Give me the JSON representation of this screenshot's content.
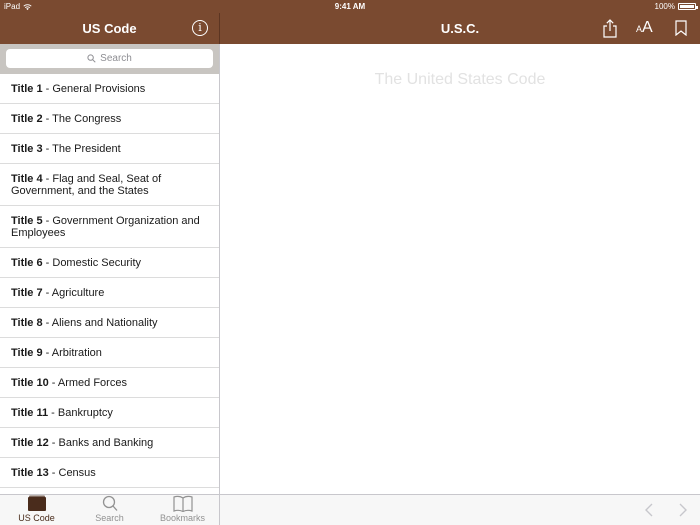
{
  "status": {
    "device": "iPad",
    "time": "9:41 AM",
    "battery": "100%"
  },
  "left_nav": {
    "title": "US Code",
    "info_glyph": "i"
  },
  "right_nav": {
    "title": "U.S.C.",
    "font_small": "A",
    "font_large": "A"
  },
  "search": {
    "placeholder": "Search"
  },
  "titles": [
    {
      "num": "Title 1",
      "name": " - General Provisions"
    },
    {
      "num": "Title 2",
      "name": " - The Congress"
    },
    {
      "num": "Title 3",
      "name": " - The President"
    },
    {
      "num": "Title 4",
      "name": " - Flag and Seal, Seat of Government, and the States"
    },
    {
      "num": "Title 5",
      "name": " - Government Organization and Employees"
    },
    {
      "num": "Title 6",
      "name": " - Domestic Security"
    },
    {
      "num": "Title 7",
      "name": " - Agriculture"
    },
    {
      "num": "Title 8",
      "name": " - Aliens and Nationality"
    },
    {
      "num": "Title 9",
      "name": " - Arbitration"
    },
    {
      "num": "Title 10",
      "name": " - Armed Forces"
    },
    {
      "num": "Title 11",
      "name": " - Bankruptcy"
    },
    {
      "num": "Title 12",
      "name": " - Banks and Banking"
    },
    {
      "num": "Title 13",
      "name": " - Census"
    }
  ],
  "content": {
    "title": "The United States Code"
  },
  "tabs": [
    {
      "label": "US Code",
      "icon": "us-code-icon"
    },
    {
      "label": "Search",
      "icon": "search-icon"
    },
    {
      "label": "Bookmarks",
      "icon": "bookmarks-icon"
    }
  ],
  "colors": {
    "bar": "#7a4a30",
    "active_tab": "#4a2c1c",
    "inactive_tab": "#929292"
  }
}
